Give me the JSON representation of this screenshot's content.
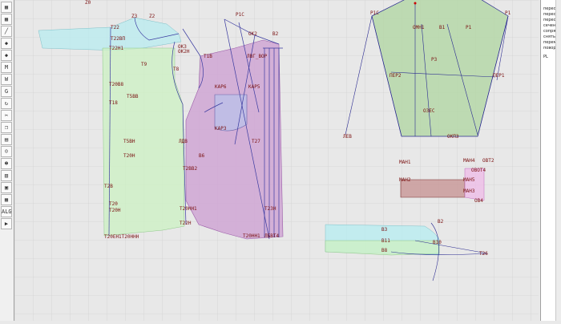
{
  "toolbar": {
    "tools": [
      {
        "name": "pointer-tool",
        "glyph": "▦"
      },
      {
        "name": "grid-tool",
        "glyph": "▦"
      },
      {
        "name": "line-tool",
        "glyph": "╱"
      },
      {
        "name": "curve-tool",
        "glyph": "◆"
      },
      {
        "name": "mirror-tool",
        "glyph": "◆"
      },
      {
        "name": "measure-tool",
        "glyph": "M"
      },
      {
        "name": "width-tool",
        "glyph": "W"
      },
      {
        "name": "gradation-tool",
        "glyph": "G"
      },
      {
        "name": "rotate-tool",
        "glyph": "↻"
      },
      {
        "name": "cut-tool",
        "glyph": "✂"
      },
      {
        "name": "copy-tool",
        "glyph": "❐"
      },
      {
        "name": "grade-tool",
        "glyph": "▤"
      },
      {
        "name": "person-tool",
        "glyph": "☺"
      },
      {
        "name": "figure-tool",
        "glyph": "☻"
      },
      {
        "name": "fill-tool",
        "glyph": "▥"
      },
      {
        "name": "print-tool",
        "glyph": "▣"
      },
      {
        "name": "layers-tool",
        "glyph": "▦"
      },
      {
        "name": "algorithm-tool",
        "glyph": "ALG"
      },
      {
        "name": "run-tool",
        "glyph": "▶"
      }
    ]
  },
  "right_panel": {
    "lines": [
      "пересе",
      "пересе",
      "пересе",
      "сечени",
      "сопря",
      "сняты",
      "переме",
      "поворо"
    ],
    "bottom_label": "РL"
  },
  "canvas": {
    "labels": {
      "z0": "Z0",
      "z3": "Z3",
      "z2": "Z2",
      "t22": "Т22",
      "t22p": "Т22ВП",
      "t22h": "Т22Н1",
      "t9": "Т9",
      "t8": "Т8",
      "z0b": "Т20В8",
      "t5b": "Т5ВВ",
      "t18": "Т18",
      "t20h": "Т20Н",
      "t20": "Т20",
      "t50h": "Т5ВН",
      "t2": "Т2В",
      "t2b": "Т2ВВ2",
      "t26": "Т20ЕН1Т20ННН",
      "p1c": "Р1С",
      "v1c": "В1С",
      "bm": "В2",
      "b1": "В1",
      "ok2": "ОК2",
      "ok3": "ОК3",
      "ok4": "ОК2Н",
      "pd": "ЛДВ",
      "kar": "КАР5",
      "kar2": "КАР6",
      "kar3": "КАР3",
      "b6": "В6",
      "b5": "В5",
      "b7": "В7",
      "b4": "Т2Л",
      "b3": "Т23Н",
      "n20": "Т20НН1",
      "n22": "Т22Н",
      "l1": "ЛБВТ4",
      "l2": "ЛВГ_ВОР",
      "l3": "Т26",
      "l4": "Т1В",
      "l5": "Т13",
      "l6": "Т27",
      "l7": "Т23Н",
      "r1": "Р1С",
      "r2": "В1",
      "r3": "Р1",
      "r4": "Р1",
      "r5": "Р3",
      "r6": "ОМН1",
      "r7": "Р9",
      "r8": "ПЕР2",
      "r9": "ПЕР1",
      "r10": "О3ЕС",
      "r11": "ЛЕВ",
      "r12": "ОКП3",
      "m1": "МАН1",
      "m2": "МАН2",
      "m3": "МАН3",
      "m4": "МАН4",
      "m5": "МАН5",
      "m6": "ОВОТ4",
      "m7": "ОВТ2",
      "m8": "ОВ4",
      "c1": "ВЗ",
      "c2": "В11",
      "c3": "В8",
      "c4": "В2",
      "c5": "В10",
      "c6": "Т26"
    }
  }
}
